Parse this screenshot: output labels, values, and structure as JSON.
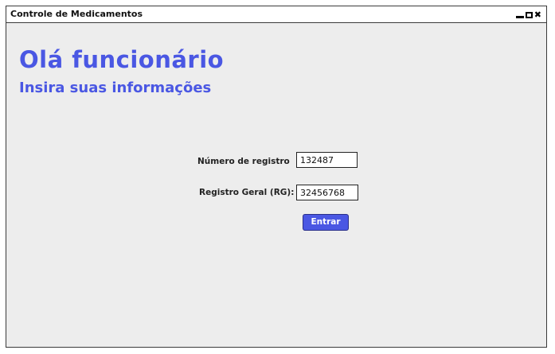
{
  "window": {
    "title": "Controle de Medicamentos"
  },
  "main": {
    "heading": "Olá funcionário",
    "subheading": "Insira suas informações"
  },
  "form": {
    "registro_label": "Número de registro",
    "registro_value": "132487",
    "rg_label": "Registro Geral (RG):",
    "rg_value": "32456768",
    "submit_label": "Entrar"
  },
  "colors": {
    "accent": "#4a57e3",
    "window_bg": "#ededed"
  }
}
